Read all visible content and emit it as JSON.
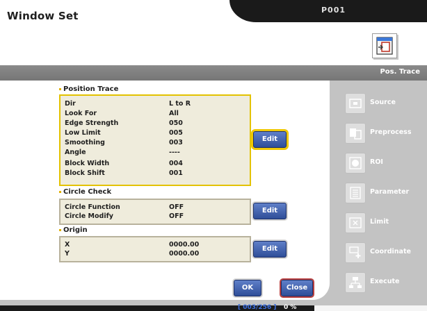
{
  "window": {
    "title": "Window Set",
    "page_id": "P001"
  },
  "band": {
    "label": "Pos. Trace"
  },
  "position_trace": {
    "title": "Position Trace",
    "rows": [
      {
        "label": "Dir",
        "value": "L to R"
      },
      {
        "label": "Look For",
        "value": "All"
      },
      {
        "label": "Edge Strength",
        "value": "050"
      },
      {
        "label": "Low Limit",
        "value": "005"
      },
      {
        "label": "Smoothing",
        "value": "003"
      },
      {
        "label": "Angle",
        "value": "----"
      },
      {
        "label": "Block Width",
        "value": "004"
      },
      {
        "label": "Block Shift",
        "value": "001"
      }
    ],
    "edit_label": "Edit"
  },
  "circle_check": {
    "title": "Circle Check",
    "rows": [
      {
        "label": "Circle Function",
        "value": "OFF"
      },
      {
        "label": "Circle Modify",
        "value": "OFF"
      }
    ],
    "edit_label": "Edit"
  },
  "origin": {
    "title": "Origin",
    "rows": [
      {
        "label": "X",
        "value": "0000.00"
      },
      {
        "label": "Y",
        "value": "0000.00"
      }
    ],
    "edit_label": "Edit"
  },
  "dialog_buttons": {
    "ok": "OK",
    "close": "Close"
  },
  "sidebar": {
    "items": [
      {
        "label": "Source",
        "icon": "source-icon"
      },
      {
        "label": "Preprocess",
        "icon": "preprocess-icon"
      },
      {
        "label": "ROI",
        "icon": "roi-icon"
      },
      {
        "label": "Parameter",
        "icon": "parameter-icon"
      },
      {
        "label": "Limit",
        "icon": "limit-icon"
      },
      {
        "label": "Coordinate",
        "icon": "coordinate-icon"
      },
      {
        "label": "Execute",
        "icon": "execute-icon"
      }
    ]
  },
  "status": {
    "counter": "[ 003/256 ]",
    "percent": "0 %"
  },
  "colors": {
    "highlight": "#e3c200",
    "button": "#2f4e99",
    "band": "#7a7a7a"
  }
}
